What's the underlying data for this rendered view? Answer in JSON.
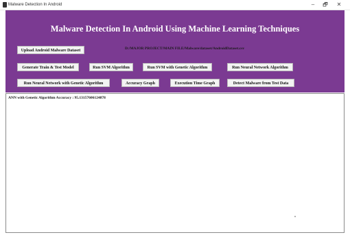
{
  "window": {
    "title": "Malware Detection In Android",
    "minimize_glyph": "–",
    "maximize_glyph": "🗗",
    "close_glyph": "✕"
  },
  "app": {
    "header": "Malware Detection In Android Using Machine Learning Techniques",
    "dataset_path": "D:/MAJOR PROJECT/MAIN FILE/Malware/dataset/AndroidDataset.csv"
  },
  "buttons": {
    "upload": "Upload Android Malware Dataset",
    "generate": "Generate Train & Test Model",
    "svm": "Run SVM Algorithm",
    "svm_ga": "Run SVM with Genetic Algorithm",
    "nn": "Run Neural Network Algorithm",
    "nn_ga": "Run Neural Network with Genetic Algorithm",
    "accuracy_graph": "Accuracy Graph",
    "time_graph": "Execution Time Graph",
    "detect": "Detect Malware from Test Data"
  },
  "output": {
    "text": "ANN with Genetic Algorithm Accuracy : 95.13157606124878"
  },
  "colors": {
    "panel": "#7b3a92",
    "button_bg": "#f3f3f3"
  }
}
